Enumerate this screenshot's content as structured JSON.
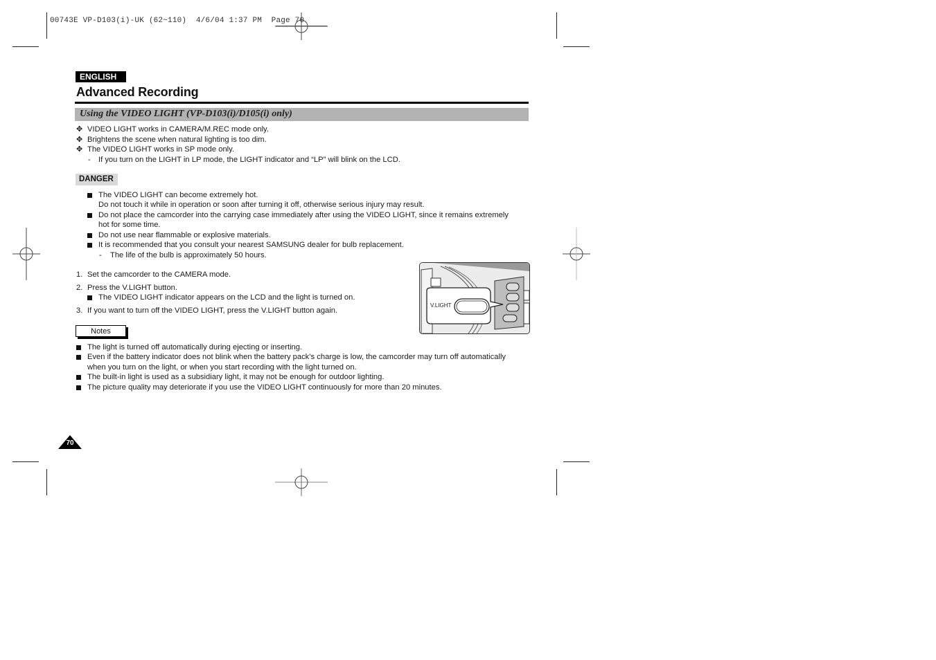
{
  "crop_header": "00743E VP-D103(i)-UK (62~110)  4/6/04 1:37 PM  Page 70",
  "language_badge": "ENGLISH",
  "page_title": "Advanced Recording",
  "section_title": "Using the VIDEO LIGHT (VP-D103(i)/D105(i) only)",
  "intro_bullets": [
    "VIDEO LIGHT works in CAMERA/M.REC mode only.",
    "Brightens the scene when natural lighting is too dim.",
    "The VIDEO LIGHT works in SP mode only."
  ],
  "intro_sub": "If you turn on the LIGHT in LP mode, the LIGHT indicator and “LP” will blink on the LCD.",
  "danger": {
    "label": "DANGER",
    "items": [
      {
        "line1": "The VIDEO LIGHT can become extremely hot.",
        "line2": "Do not touch it while in operation or soon after turning it off, otherwise serious injury may result."
      },
      {
        "line1": "Do not place the camcorder into the carrying case immediately after using the VIDEO LIGHT, since it remains extremely",
        "line2": "hot for some time."
      },
      {
        "line1": "Do not use near flammable or explosive materials."
      },
      {
        "line1": "It is recommended that you consult your nearest SAMSUNG dealer for bulb replacement."
      }
    ],
    "sub": "The life of the bulb is approximately 50 hours."
  },
  "steps": [
    {
      "num": "1.",
      "text": "Set the camcorder to the CAMERA mode."
    },
    {
      "num": "2.",
      "text": "Press the V.LIGHT button.",
      "sub": "The VIDEO LIGHT indicator appears on the LCD and the light is turned on."
    },
    {
      "num": "3.",
      "text": "If you want to turn off the VIDEO LIGHT, press the V.LIGHT button again."
    }
  ],
  "illustration": {
    "button_label": "V.LIGHT"
  },
  "notes": {
    "label": "Notes",
    "items": [
      {
        "line1": "The light is turned off automatically during ejecting or inserting."
      },
      {
        "line1": "Even if the battery indicator does not blink when the battery pack’s charge is low, the camcorder may turn off automatically",
        "line2": "when you turn on the light, or when you start recording with the light turned on."
      },
      {
        "line1": "The built-in light is used as a subsidiary light, it may not be enough for outdoor lighting."
      },
      {
        "line1": "The picture quality may deteriorate if you use the VIDEO LIGHT continuously for more than 20 minutes."
      }
    ]
  },
  "page_number": "70"
}
